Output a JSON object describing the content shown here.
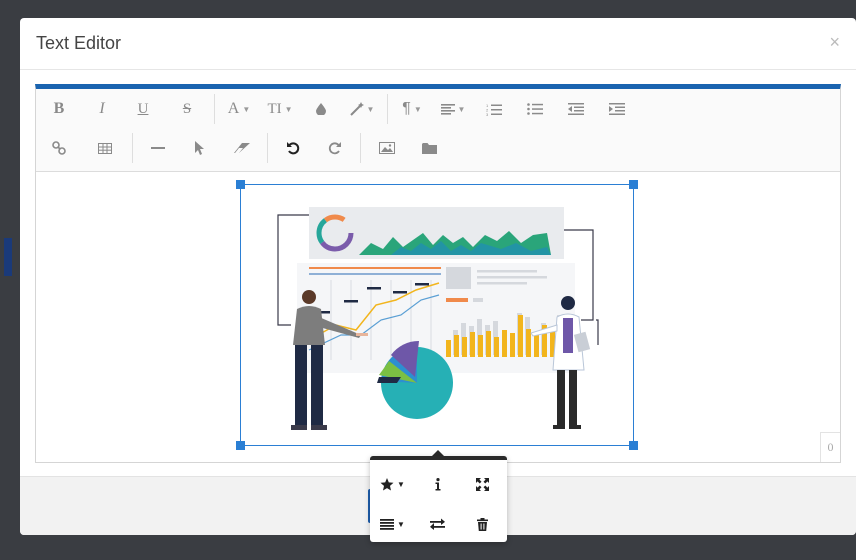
{
  "modal": {
    "title": "Text Editor",
    "close_glyph": "×"
  },
  "toolbar": {
    "row1": [
      {
        "name": "bold-button",
        "glyph": "B",
        "icon": "bold-icon"
      },
      {
        "name": "italic-button",
        "glyph": "I",
        "icon": "italic-icon"
      },
      {
        "name": "underline-button",
        "glyph": "U",
        "icon": "underline-icon"
      },
      {
        "name": "strikethrough-button",
        "glyph": "S",
        "icon": "strikethrough-icon"
      },
      {
        "name": "font-family-button",
        "glyph": "A",
        "icon": "font-icon",
        "dropdown": true
      },
      {
        "name": "font-size-button",
        "glyph": "TI",
        "icon": "text-size-icon",
        "dropdown": true
      },
      {
        "name": "text-color-button",
        "glyph": "💧",
        "icon": "droplet-icon"
      },
      {
        "name": "paragraph-style-button",
        "glyph": "✎",
        "icon": "magic-wand-icon",
        "dropdown": true
      },
      {
        "name": "paragraph-format-button",
        "glyph": "¶",
        "icon": "pilcrow-icon",
        "dropdown": true
      },
      {
        "name": "align-button",
        "glyph": "≡",
        "icon": "align-icon",
        "dropdown": true
      },
      {
        "name": "ordered-list-button",
        "glyph": "≔",
        "icon": "ordered-list-icon"
      },
      {
        "name": "unordered-list-button",
        "glyph": "☰",
        "icon": "unordered-list-icon"
      },
      {
        "name": "outdent-button",
        "glyph": "⇤",
        "icon": "outdent-icon"
      },
      {
        "name": "indent-button",
        "glyph": "⇥",
        "icon": "indent-icon"
      }
    ],
    "row2": [
      {
        "name": "insert-link-button",
        "glyph": "🔗",
        "icon": "link-icon"
      },
      {
        "name": "insert-table-button",
        "glyph": "▦",
        "icon": "table-icon"
      },
      {
        "name": "horizontal-line-button",
        "glyph": "—",
        "icon": "horizontal-line-icon"
      },
      {
        "name": "select-all-button",
        "glyph": "➤",
        "icon": "cursor-icon"
      },
      {
        "name": "clear-formatting-button",
        "glyph": "◇",
        "icon": "eraser-icon"
      },
      {
        "name": "undo-button",
        "glyph": "↶",
        "icon": "undo-icon"
      },
      {
        "name": "redo-button",
        "glyph": "↷",
        "icon": "redo-icon"
      },
      {
        "name": "insert-image-button",
        "glyph": "🖼",
        "icon": "image-icon"
      },
      {
        "name": "file-manager-button",
        "glyph": "📁",
        "icon": "folder-icon"
      }
    ]
  },
  "content": {
    "char_count": "0"
  },
  "image_popover": {
    "row1": [
      {
        "name": "image-style-button",
        "icon": "star-icon",
        "dropdown": true
      },
      {
        "name": "image-alt-button",
        "icon": "info-icon"
      },
      {
        "name": "image-size-button",
        "icon": "expand-icon"
      }
    ],
    "row2": [
      {
        "name": "image-align-button",
        "icon": "align-justify-icon",
        "dropdown": true
      },
      {
        "name": "image-replace-button",
        "icon": "swap-icon"
      },
      {
        "name": "image-remove-button",
        "icon": "trash-icon"
      }
    ]
  },
  "colors": {
    "accent": "#1a64b0",
    "selection": "#2b7fd4",
    "teal": "#26a69a",
    "gold": "#f2b51d",
    "purple": "#7b5cab"
  }
}
